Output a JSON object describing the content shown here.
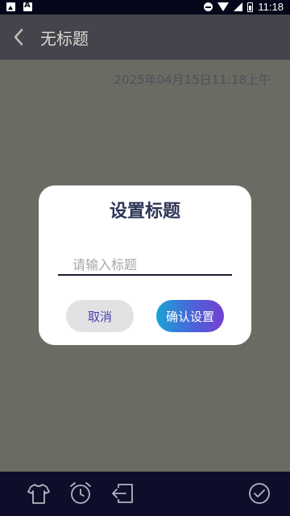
{
  "status_bar": {
    "time": "11:18",
    "icons": [
      "image-icon",
      "font-icon",
      "do-not-disturb-icon",
      "wifi-icon",
      "signal-icon",
      "battery-icon"
    ]
  },
  "app_bar": {
    "title": "无标题",
    "back_icon": "chevron-left-icon"
  },
  "content": {
    "date": "2025年04月15日11:18上午"
  },
  "dialog": {
    "title": "设置标题",
    "input_placeholder": "请输入标题",
    "input_value": "",
    "cancel_label": "取消",
    "confirm_label": "确认设置"
  },
  "bottom_bar": {
    "icons": [
      "shirt-icon",
      "alarm-clock-icon",
      "export-icon",
      "check-circle-icon"
    ]
  },
  "colors": {
    "app_bar": "#0e0e2a",
    "content_bg": "#4a4a4e",
    "dialog_bg": "#ffffff",
    "cancel_bg": "#e2e2e4",
    "cancel_text": "#4b3fb0",
    "confirm_gradient_start": "#1aa3d6",
    "confirm_gradient_end": "#7540d2",
    "title_text": "#2f3658"
  }
}
